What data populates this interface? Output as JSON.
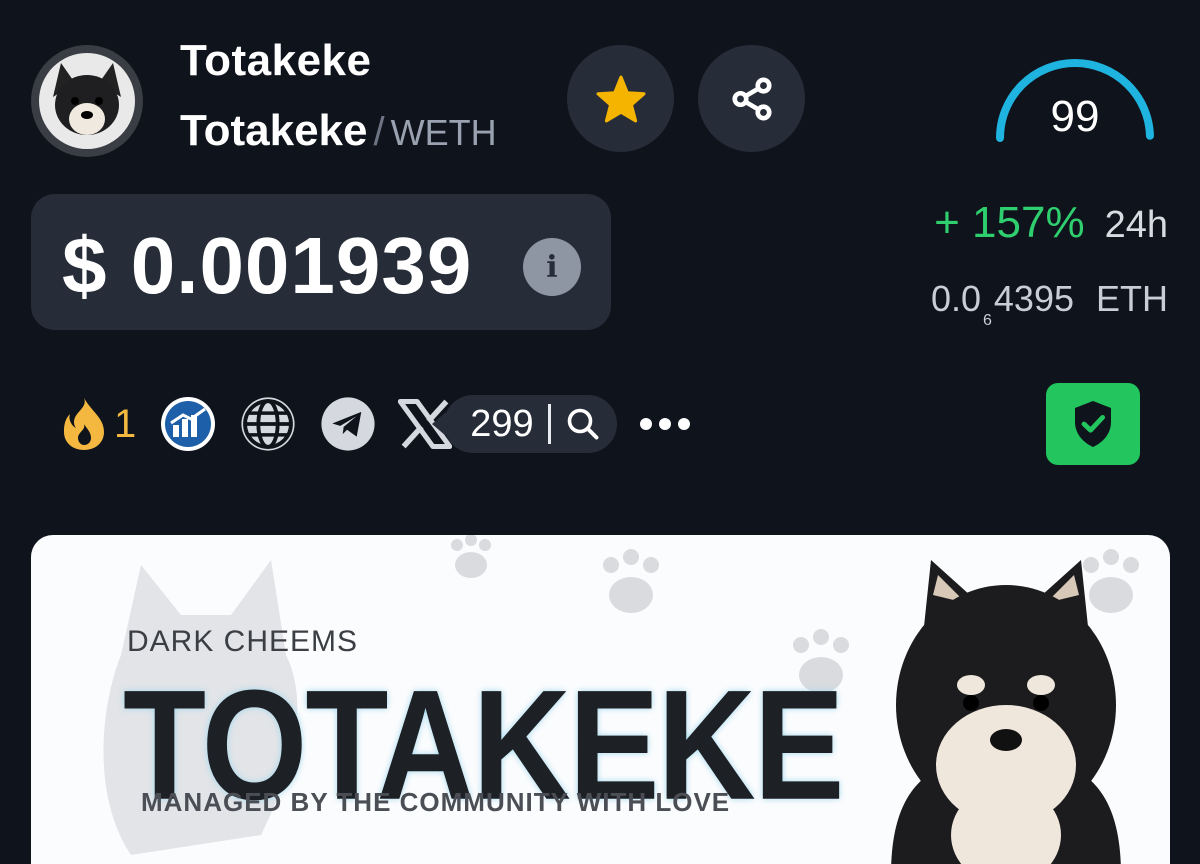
{
  "token": {
    "name": "Totakeke",
    "pair_base": "Totakeke",
    "pair_separator": "/",
    "pair_quote": "WETH",
    "avatar_label": "TOTAKEKE"
  },
  "score": {
    "value": "99",
    "level": 0.99
  },
  "price": {
    "usd": "$ 0.001939",
    "change_24h": "+ 157%",
    "change_period": "24h",
    "eth_lead": "0.0",
    "eth_zero_count": "6",
    "eth_tail": "4395",
    "eth_unit": "ETH"
  },
  "links": {
    "fire_count": "1",
    "x_count": "299"
  },
  "banner": {
    "kicker": "DARK CHEEMS",
    "title": "TOTAKEKE",
    "tagline": "MANAGED BY THE COMMUNITY WITH LOVE"
  },
  "colors": {
    "background": "#0f141c",
    "card": "#262d38",
    "positive": "#2fce6e",
    "star": "#f4b400",
    "gauge": "#1fb3e0",
    "audit_green": "#22c55e"
  },
  "icons": [
    "star-icon",
    "share-icon",
    "info-icon",
    "fire-icon",
    "chart-icon",
    "globe-icon",
    "telegram-icon",
    "x-logo-icon",
    "search-icon",
    "more-icon",
    "shield-check-icon"
  ]
}
